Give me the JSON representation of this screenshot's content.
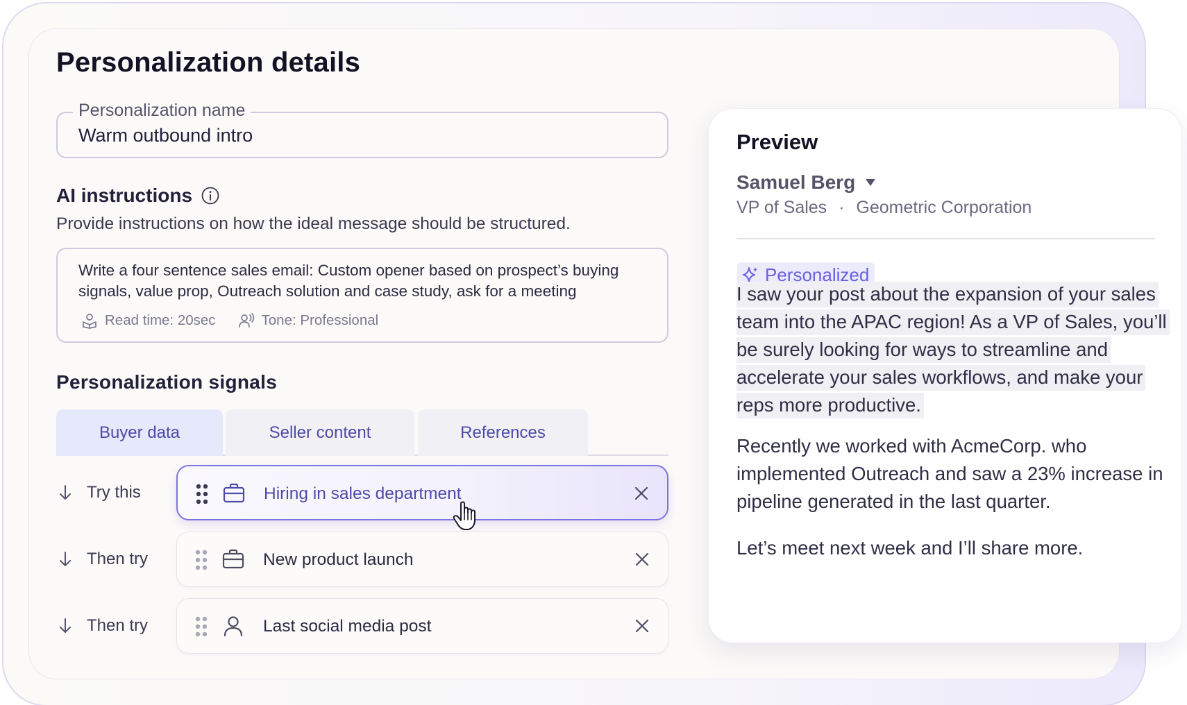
{
  "details": {
    "title": "Personalization details",
    "name_field": {
      "label": "Personalization name",
      "value": "Warm outbound intro"
    },
    "ai_instructions": {
      "title": "AI instructions",
      "subtitle": "Provide instructions on how the ideal message should be structured.",
      "text": "Write a four sentence sales email: Custom opener based on prospect’s buying signals, value prop, Outreach solution and case study, ask for a meeting",
      "read_time": "Read time: 20sec",
      "tone": "Tone: Professional"
    },
    "signals": {
      "title": "Personalization signals",
      "tabs": [
        {
          "label": "Buyer data",
          "active": true
        },
        {
          "label": "Seller content",
          "active": false
        },
        {
          "label": "References",
          "active": false
        }
      ],
      "rows": [
        {
          "step": "Try this",
          "label": "Hiring in sales department",
          "icon": "briefcase-icon",
          "active": true
        },
        {
          "step": "Then try",
          "label": "New product launch",
          "icon": "briefcase-icon",
          "active": false
        },
        {
          "step": "Then try",
          "label": "Last social media post",
          "icon": "person-icon",
          "active": false
        }
      ]
    }
  },
  "preview": {
    "title": "Preview",
    "contact_name": "Samuel Berg",
    "contact_role": "VP of Sales",
    "contact_company": "Geometric Corporation",
    "role_separator": "·",
    "badge": "Personalized",
    "highlighted_text": "I saw your post about the expansion of your sales team into the APAC region! As a VP of Sales, you’ll be surely looking for ways to streamline and accelerate your sales workflows, and make your reps more productive.",
    "paragraph_2": "Recently we worked with AcmeCorp. who implemented Outreach and saw a 23% increase in pipeline generated in the last quarter.",
    "paragraph_3": "Let’s meet next week and I’ll share more."
  },
  "colors": {
    "accent": "#6a5fe0",
    "tab_active_bg": "#e6e8fb",
    "text_dark": "#131224"
  }
}
